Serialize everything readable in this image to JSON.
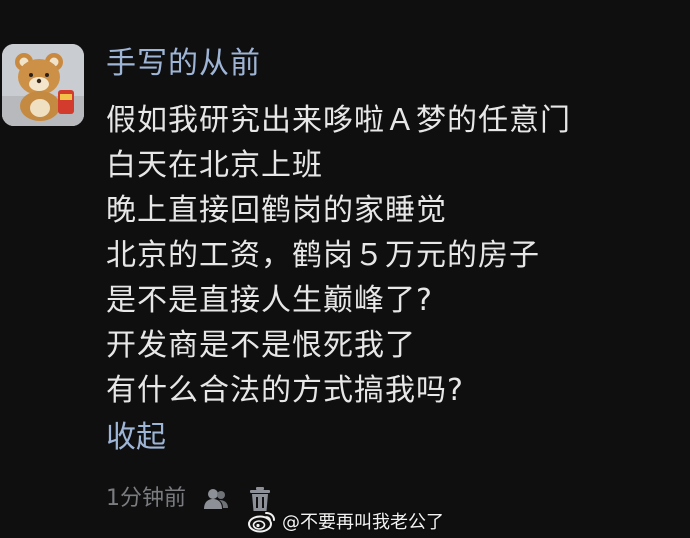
{
  "comment": {
    "username": "手写的从前",
    "lines": [
      "假如我研究出来哆啦Ａ梦的任意门",
      "白天在北京上班",
      "晚上直接回鹤岗的家睡觉",
      "北京的工资，鹤岗５万元的房子",
      "是不是直接人生巅峰了?",
      "开发商是不是恨死我了",
      "有什么合法的方式搞我吗?"
    ],
    "collapse_label": "收起",
    "timestamp": "1分钟前",
    "icons": {
      "avatar": "bear-plush-avatar",
      "manage": "users-icon",
      "delete": "trash-icon"
    }
  },
  "watermark": {
    "text": "@不要再叫我老公了",
    "icon": "weibo-logo-icon"
  },
  "colors": {
    "background": "#0f0f10",
    "link": "#9fb5d6",
    "text": "#e7e7e7",
    "muted": "#7a7c80"
  }
}
